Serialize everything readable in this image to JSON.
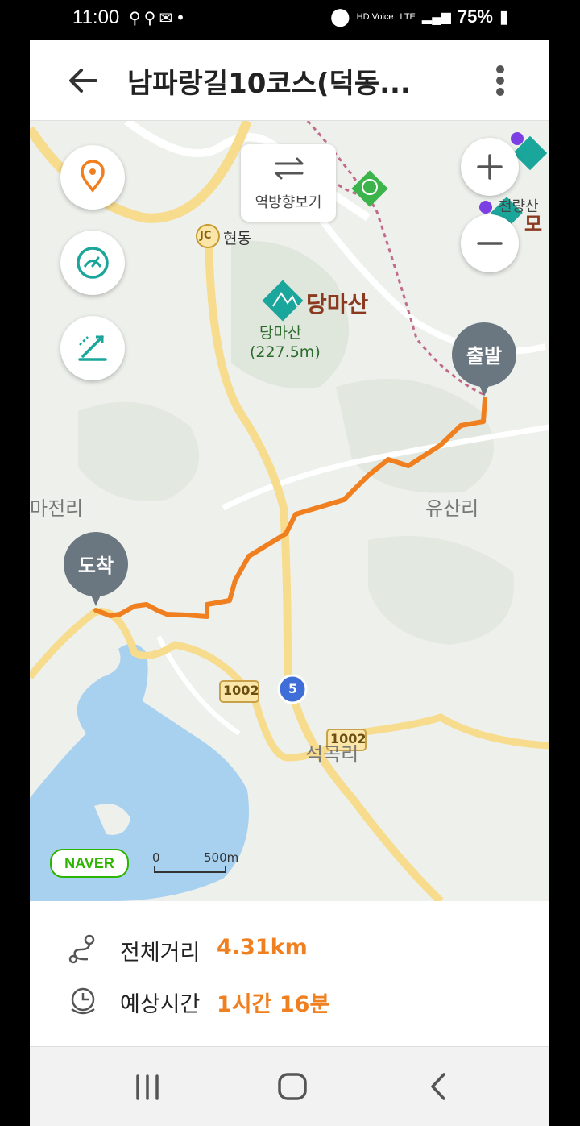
{
  "status_bar": {
    "time": "11:00",
    "voice_label": "HD Voice",
    "network": "LTE",
    "battery": "75%"
  },
  "header": {
    "title": "남파랑길10코스(덕동..."
  },
  "map": {
    "reverse_button_label": "역방향보기",
    "labels": {
      "junction_badge": "JC",
      "junction": "현동",
      "mountain_title": "당마산",
      "mountain_name": "당마산",
      "mountain_height": "(227.5m)",
      "village_west": "마전리",
      "village_east": "유산리",
      "village_south": "석곡리",
      "mountain_ne_1": "천량산",
      "mountain_ne_2": "모",
      "route_1002_a": "1002",
      "route_1002_b": "1002",
      "route_5": "5"
    },
    "start_label": "출발",
    "end_label": "도착",
    "brand": "NAVER",
    "scale_start": "0",
    "scale_end": "500m",
    "route_color": "#f07f1f"
  },
  "course_info": {
    "distance_label": "전체거리",
    "distance_value": "4.31km",
    "time_label": "예상시간",
    "time_value": "1시간 16분"
  }
}
